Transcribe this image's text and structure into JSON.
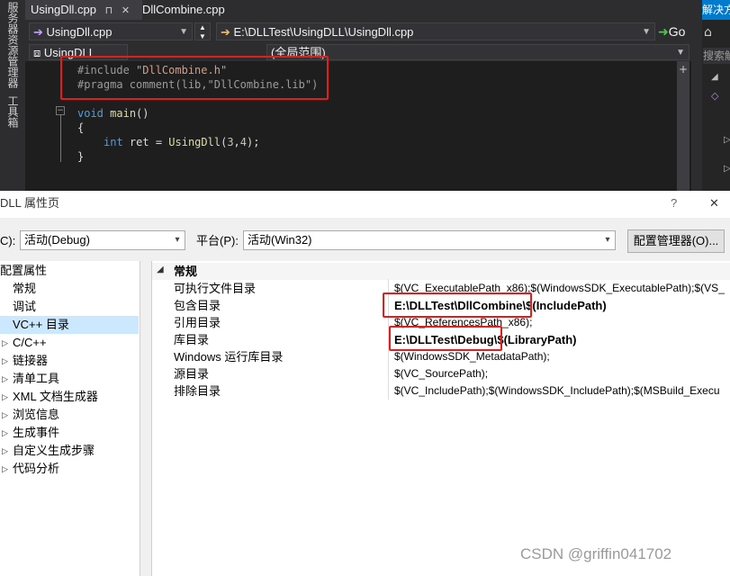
{
  "ide": {
    "tabs": [
      "UsingDll.cpp",
      "DllCombine.cpp"
    ],
    "nav_project": "UsingDll.cpp",
    "nav_path": "E:\\DLLTest\\UsingDLL\\UsingDll.cpp",
    "go_label": "Go",
    "scope_project": "UsingDLL",
    "scope": "(全局范围)",
    "side_tab_1": "服务器资源管理器",
    "side_tab_2": "工具箱",
    "right_title": "解决方",
    "right_search": "搜索解",
    "code": {
      "line1_directive": "#include",
      "line1_string": "\"DllCombine.h\"",
      "line2_directive": "#pragma comment",
      "line2_args": "(lib,\"DllCombine.lib\")",
      "line3_kw": "void",
      "line3_fn": "main",
      "line3_rest": "()",
      "line4": "{",
      "line5_kw": "int",
      "line5_var": "ret =",
      "line5_fn": "UsingDll",
      "line5_args_open": "(",
      "line5_n1": "3",
      "line5_comma": ",",
      "line5_n2": "4",
      "line5_close": ");",
      "line6": "}"
    }
  },
  "dialog": {
    "title": "DLL 属性页",
    "help": "?",
    "close": "✕",
    "config_label": "C):",
    "config_value": "活动(Debug)",
    "platform_label": "平台(P):",
    "platform_value": "活动(Win32)",
    "config_manager": "配置管理器(O)...",
    "tree": [
      {
        "label": "配置属性"
      },
      {
        "label": "常规"
      },
      {
        "label": "调试"
      },
      {
        "label": "VC++ 目录"
      },
      {
        "label": "C/C++"
      },
      {
        "label": "链接器"
      },
      {
        "label": "清单工具"
      },
      {
        "label": "XML 文档生成器"
      },
      {
        "label": "浏览信息"
      },
      {
        "label": "生成事件"
      },
      {
        "label": "自定义生成步骤"
      },
      {
        "label": "代码分析"
      }
    ],
    "section": "常规",
    "rows": [
      {
        "name": "可执行文件目录",
        "value": "$(VC_ExecutablePath_x86);$(WindowsSDK_ExecutablePath);$(VS_"
      },
      {
        "name": "包含目录",
        "value_bold": "E:\\DLLTest\\DllCombine\\",
        "value_rest": "$(IncludePath)"
      },
      {
        "name": "引用目录",
        "value": "$(VC_ReferencesPath_x86);"
      },
      {
        "name": "库目录",
        "value_bold": "E:\\DLLTest\\Debug\\",
        "value_rest": "$(LibraryPath)"
      },
      {
        "name": "Windows 运行库目录",
        "value": "$(WindowsSDK_MetadataPath);"
      },
      {
        "name": "源目录",
        "value": "$(VC_SourcePath);"
      },
      {
        "name": "排除目录",
        "value": "$(VC_IncludePath);$(WindowsSDK_IncludePath);$(MSBuild_Execu"
      }
    ]
  },
  "watermark": "CSDN @griffin041702",
  "colors": {
    "highlight_box": "#e51c1c",
    "selected_tree": "#cce8ff",
    "ide_bg": "#1e1e1e"
  }
}
